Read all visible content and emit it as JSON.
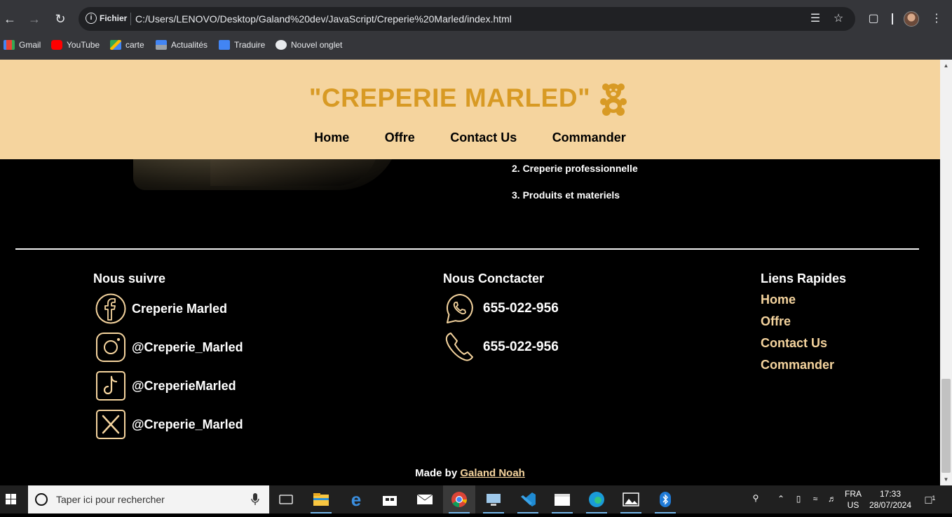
{
  "browser": {
    "url_scheme_label": "Fichier",
    "url": "C:/Users/LENOVO/Desktop/Galand%20dev/JavaScript/Creperie%20Marled/index.html",
    "bookmarks": [
      {
        "label": "Gmail",
        "icon": "gmail-icon"
      },
      {
        "label": "YouTube",
        "icon": "youtube-icon"
      },
      {
        "label": "carte",
        "icon": "maps-icon"
      },
      {
        "label": "Actualités",
        "icon": "news-icon"
      },
      {
        "label": "Traduire",
        "icon": "translate-icon"
      },
      {
        "label": "Nouvel onglet",
        "icon": "globe-icon"
      }
    ]
  },
  "site": {
    "brand": "\"CREPERIE MARLED\"",
    "menu": [
      "Home",
      "Offre",
      "Contact Us",
      "Commander"
    ],
    "list_items": [
      "2. Creperie professionnelle",
      "3. Produits et materiels"
    ],
    "footer": {
      "follow_title": "Nous suivre",
      "socials": [
        {
          "icon": "facebook-icon",
          "label": "Creperie Marled"
        },
        {
          "icon": "instagram-icon",
          "label": "@Creperie_Marled"
        },
        {
          "icon": "tiktok-icon",
          "label": "@CreperieMarled"
        },
        {
          "icon": "x-icon",
          "label": "@Creperie_Marled"
        }
      ],
      "contact_title": "Nous Conctacter",
      "contacts": [
        {
          "icon": "whatsapp-icon",
          "label": "655-022-956"
        },
        {
          "icon": "phone-icon",
          "label": "655-022-956"
        }
      ],
      "links_title": "Liens Rapides",
      "links": [
        "Home",
        "Offre",
        "Contact Us",
        "Commander"
      ],
      "credits_prefix": "Made by",
      "credits_author": "Galand Noah"
    },
    "colors": {
      "header_bg": "#f5d49e",
      "brand": "#d89a24",
      "accent": "#f5d49e"
    }
  },
  "taskbar": {
    "search_placeholder": "Taper ici pour rechercher",
    "language": "FRA",
    "layout": "US",
    "time": "17:33",
    "date": "28/07/2024",
    "notifications": "1"
  }
}
